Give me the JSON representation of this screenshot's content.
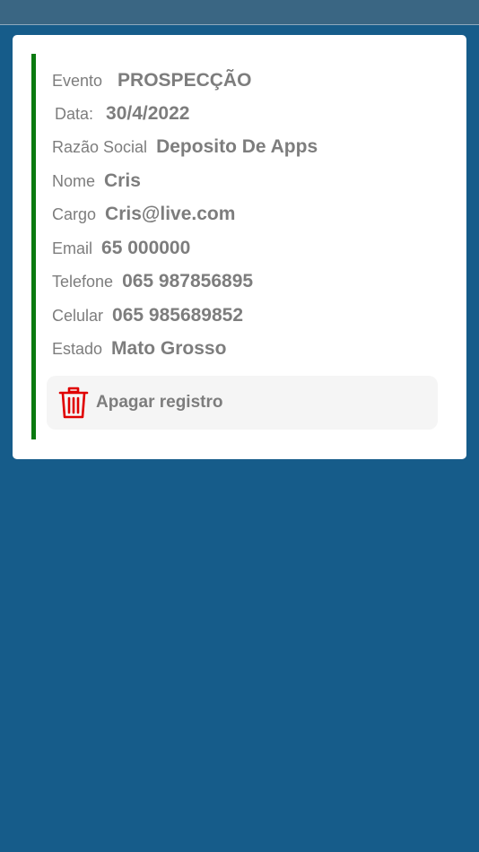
{
  "record": {
    "fields": [
      {
        "label": "Evento",
        "value": "PROSPECÇÃO"
      },
      {
        "label": "Data:",
        "value": "30/4/2022"
      },
      {
        "label": "Razão Social",
        "value": "Deposito De Apps"
      },
      {
        "label": "Nome",
        "value": "Cris"
      },
      {
        "label": "Cargo",
        "value": "Cris@live.com"
      },
      {
        "label": "Email",
        "value": "65 000000"
      },
      {
        "label": "Telefone",
        "value": "065 987856895"
      },
      {
        "label": "Celular",
        "value": "065 985689852"
      },
      {
        "label": "Estado",
        "value": "Mato Grosso"
      }
    ],
    "delete_label": "Apagar registro",
    "delete_icon": "trash-icon"
  },
  "colors": {
    "background": "#165c8a",
    "accent": "#0a7a10",
    "delete_icon": "#e00000",
    "text": "#7d7d7d"
  }
}
